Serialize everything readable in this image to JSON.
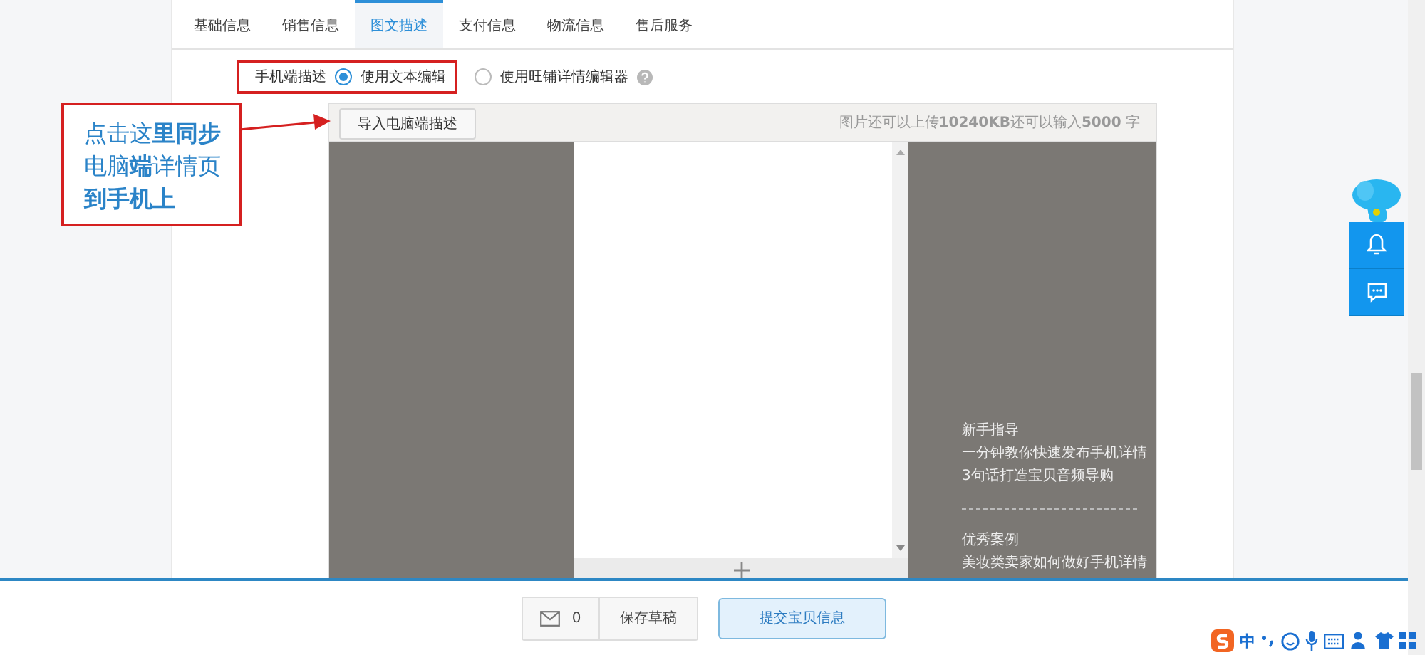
{
  "tabs": [
    {
      "label": "基础信息",
      "selected": false
    },
    {
      "label": "销售信息",
      "selected": false
    },
    {
      "label": "图文描述",
      "selected": true
    },
    {
      "label": "支付信息",
      "selected": false
    },
    {
      "label": "物流信息",
      "selected": false
    },
    {
      "label": "售后服务",
      "selected": false
    }
  ],
  "mobile_description": {
    "label": "手机端描述",
    "options": [
      {
        "label": "使用文本编辑",
        "selected": true
      },
      {
        "label": "使用旺铺详情编辑器",
        "selected": false
      }
    ]
  },
  "annotation": {
    "lines": [
      "点击这**里同步**",
      "电脑**端**详情页",
      "**到手机上**"
    ]
  },
  "editor": {
    "import_button": "导入电脑端描述",
    "quota": "图片还可以上传**10240KB**还可以输入**5000** 字"
  },
  "guide": {
    "sections": [
      {
        "title": "新手指导",
        "items": [
          "一分钟教你快速发布手机详情",
          "3句话打造宝贝音频导购"
        ]
      },
      {
        "title": "优秀案例",
        "items": [
          "美妆类卖家如何做好手机详情"
        ]
      }
    ]
  },
  "footer": {
    "message_count": "0",
    "save_button": "保存草稿",
    "submit_button": "提交宝贝信息"
  },
  "ime": {
    "mode": "中"
  }
}
